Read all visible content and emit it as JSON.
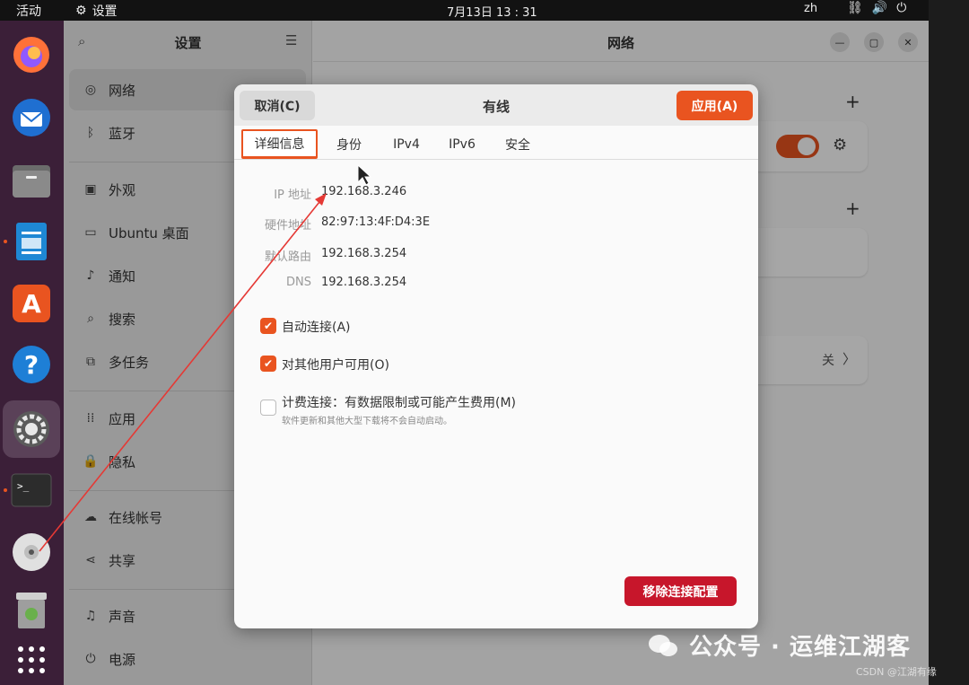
{
  "topbar": {
    "activities": "活动",
    "app_name": "设置",
    "clock": "7月13日  13 : 31",
    "lang": "zh"
  },
  "dock": {
    "items": [
      "firefox-icon",
      "thunderbird-icon",
      "files-icon",
      "writer-icon",
      "app-center-icon",
      "help-icon",
      "settings-icon",
      "terminal-icon",
      "disc-icon",
      "trash-icon",
      "app-grid-icon"
    ]
  },
  "sidebar": {
    "title": "设置",
    "items": [
      {
        "label": "网络",
        "icon": "network-icon"
      },
      {
        "label": "蓝牙",
        "icon": "bluetooth-icon"
      },
      {
        "label": "外观",
        "icon": "appearance-icon"
      },
      {
        "label": "Ubuntu 桌面",
        "icon": "desktop-icon"
      },
      {
        "label": "通知",
        "icon": "bell-icon"
      },
      {
        "label": "搜索",
        "icon": "search-icon"
      },
      {
        "label": "多任务",
        "icon": "multitask-icon"
      },
      {
        "label": "应用",
        "icon": "apps-icon"
      },
      {
        "label": "隐私",
        "icon": "lock-icon"
      },
      {
        "label": "在线帐号",
        "icon": "cloud-icon"
      },
      {
        "label": "共享",
        "icon": "share-icon"
      },
      {
        "label": "声音",
        "icon": "music-icon"
      },
      {
        "label": "电源",
        "icon": "power-icon"
      }
    ]
  },
  "main": {
    "title": "网络",
    "proxy_value": "关"
  },
  "dialog": {
    "title": "有线",
    "cancel": "取消(C)",
    "apply": "应用(A)",
    "tabs": [
      "详细信息",
      "身份",
      "IPv4",
      "IPv6",
      "安全"
    ],
    "details": [
      {
        "label": "IP 地址",
        "value": "192.168.3.246"
      },
      {
        "label": "硬件地址",
        "value": "82:97:13:4F:D4:3E"
      },
      {
        "label": "默认路由",
        "value": "192.168.3.254"
      },
      {
        "label": "DNS",
        "value": "192.168.3.254"
      }
    ],
    "auto_connect": "自动连接(A)",
    "all_users": "对其他用户可用(O)",
    "metered": "计费连接：有数据限制或可能产生费用(M)",
    "metered_sub": "软件更新和其他大型下载将不会自动启动。",
    "remove": "移除连接配置"
  },
  "watermark": {
    "text": "公众号 · 运维江湖客",
    "source": "CSDN @江湖有缘"
  },
  "colors": {
    "accent": "#e95420",
    "danger": "#c7162b"
  }
}
